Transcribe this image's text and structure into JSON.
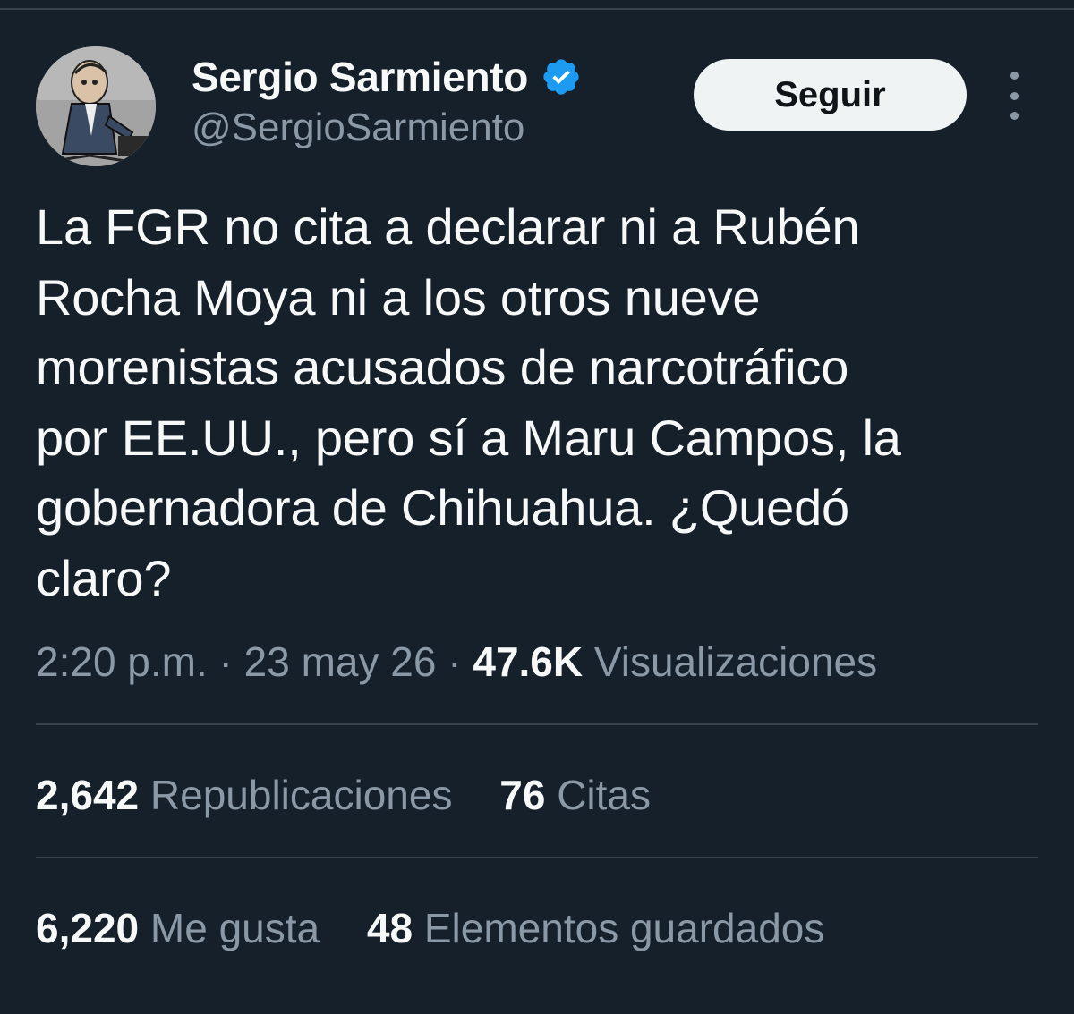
{
  "author": {
    "display_name": "Sergio Sarmiento",
    "handle": "@SergioSarmiento",
    "verified_icon": "verified-badge-icon"
  },
  "header": {
    "follow_label": "Seguir",
    "more_icon": "more-options-icon"
  },
  "tweet": {
    "text": "La FGR no cita a declarar ni a Rubén\nRocha Moya ni a los otros nueve\nmorenistas acusados de narcotráfico\npor EE.UU., pero sí a Maru Campos, la\ngobernadora de Chihuahua. ¿Quedó\nclaro?"
  },
  "meta": {
    "time": "2:20 p.m.",
    "separator": " · ",
    "date": "23 may 26",
    "views_count": "47.6K",
    "views_label": "Visualizaciones"
  },
  "stats": {
    "reposts_count": "2,642",
    "reposts_label": "Republicaciones",
    "quotes_count": "76",
    "quotes_label": "Citas",
    "likes_count": "6,220",
    "likes_label": "Me gusta",
    "bookmarks_count": "48",
    "bookmarks_label": "Elementos guardados"
  },
  "colors": {
    "background": "#15202b",
    "primary_text": "#f7f9f9",
    "secondary_text": "#8b98a5",
    "divider": "#38444d",
    "verified": "#1d9bf0"
  }
}
